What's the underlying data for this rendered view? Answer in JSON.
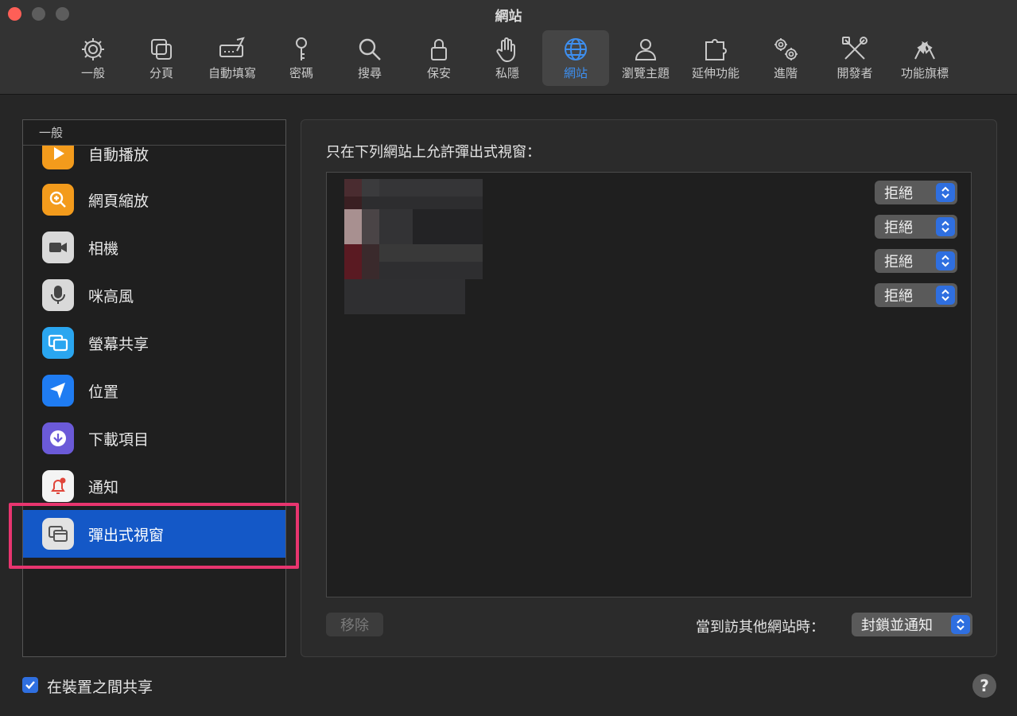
{
  "window": {
    "title": "網站"
  },
  "toolbar": {
    "items": [
      {
        "label": "一般",
        "icon": "gear-icon"
      },
      {
        "label": "分頁",
        "icon": "tabs-icon"
      },
      {
        "label": "自動填寫",
        "icon": "autofill-icon"
      },
      {
        "label": "密碼",
        "icon": "key-icon"
      },
      {
        "label": "搜尋",
        "icon": "search-icon"
      },
      {
        "label": "保安",
        "icon": "lock-icon"
      },
      {
        "label": "私隱",
        "icon": "hand-icon"
      },
      {
        "label": "網站",
        "icon": "globe-icon",
        "active": true
      },
      {
        "label": "瀏覽主題",
        "icon": "person-icon"
      },
      {
        "label": "延伸功能",
        "icon": "puzzle-icon"
      },
      {
        "label": "進階",
        "icon": "gears-icon"
      },
      {
        "label": "開發者",
        "icon": "tools-icon"
      },
      {
        "label": "功能旗標",
        "icon": "flags-icon"
      }
    ]
  },
  "sidebar": {
    "header": "一般",
    "items": [
      {
        "label": "自動播放",
        "icon": "autoplay-icon"
      },
      {
        "label": "網頁縮放",
        "icon": "zoom-icon"
      },
      {
        "label": "相機",
        "icon": "camera-icon"
      },
      {
        "label": "咪高風",
        "icon": "microphone-icon"
      },
      {
        "label": "螢幕共享",
        "icon": "screen-share-icon"
      },
      {
        "label": "位置",
        "icon": "location-icon"
      },
      {
        "label": "下載項目",
        "icon": "download-icon"
      },
      {
        "label": "通知",
        "icon": "notification-icon"
      },
      {
        "label": "彈出式視窗",
        "icon": "popup-window-icon",
        "selected": true
      }
    ]
  },
  "main": {
    "title": "只在下列網站上允許彈出式視窗：",
    "sites": [
      {
        "setting": "拒絕"
      },
      {
        "setting": "拒絕"
      },
      {
        "setting": "拒絕"
      },
      {
        "setting": "拒絕"
      }
    ],
    "remove_label": "移除",
    "other_sites_label": "當到訪其他網站時：",
    "other_sites_value": "封鎖並通知"
  },
  "footer": {
    "share_label": "在裝置之間共享",
    "share_checked": true,
    "help_label": "?"
  },
  "colors": {
    "accent": "#2f6fe0",
    "selection": "#1458c7",
    "highlight": "#e8356f"
  }
}
